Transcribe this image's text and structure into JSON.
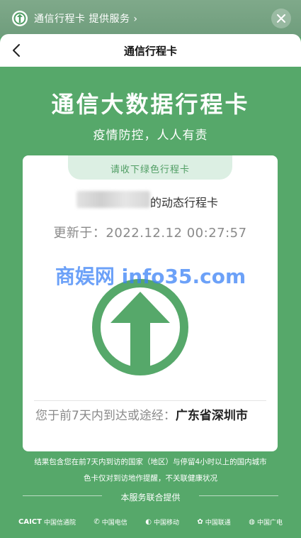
{
  "mini_program": {
    "title": "通信行程卡 提供服务 ›"
  },
  "navbar": {
    "title": "通信行程卡"
  },
  "hero": {
    "title": "通信大数据行程卡",
    "subtitle": "疫情防控，人人有责"
  },
  "card": {
    "status_tab": "请收下绿色行程卡",
    "owner_suffix": "的动态行程卡",
    "updated_label": "更新于：2022.12.12 00:27:57",
    "status_color": "#56a86a",
    "route_label": "您于前7天内到达或途经：",
    "route_value": "广东省深圳市"
  },
  "watermark": "商娱网 info35.com",
  "notes": {
    "line1": "结果包含您在前7天内到访的国家（地区）与停留4小时以上的国内城市",
    "line2": "色卡仅对到访地作提醒，不关联健康状况"
  },
  "providers": {
    "label": "本服务联合提供",
    "items": [
      {
        "mark": "CAICT",
        "name": "中国信通院"
      },
      {
        "mark": "✆",
        "name": "中国电信"
      },
      {
        "mark": "◐",
        "name": "中国移动"
      },
      {
        "mark": "✿",
        "name": "中国联通"
      },
      {
        "mark": "◍",
        "name": "中国广电"
      }
    ]
  }
}
